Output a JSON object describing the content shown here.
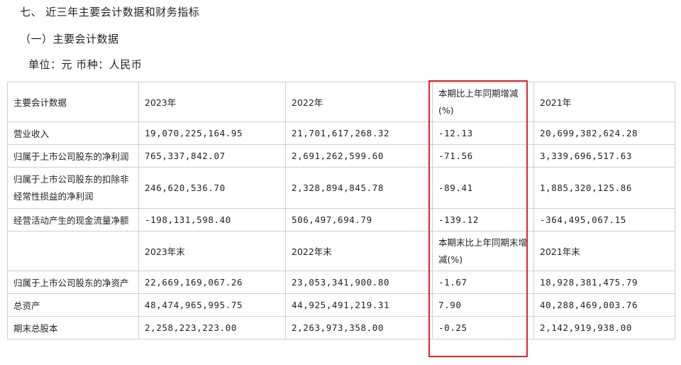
{
  "headings": {
    "section": "七、 近三年主要会计数据和财务指标",
    "subsection": "（一）主要会计数据",
    "unit_line": "单位：元  币种：人民币"
  },
  "table": {
    "header1": [
      "主要会计数据",
      "2023年",
      "2022年",
      "本期比上年同期增减(%)",
      "2021年"
    ],
    "rows1": [
      [
        "营业收入",
        "19,070,225,164.95",
        "21,701,617,268.32",
        "-12.13",
        "20,699,382,624.28"
      ],
      [
        "归属于上市公司股东的净利润",
        "765,337,842.07",
        "2,691,262,599.60",
        "-71.56",
        "3,339,696,517.63"
      ],
      [
        "归属于上市公司股东的扣除非经常性损益的净利润",
        "246,620,536.70",
        "2,328,894,845.78",
        "-89.41",
        "1,885,320,125.86"
      ],
      [
        "经营活动产生的现金流量净额",
        "-198,131,598.40",
        "506,497,694.79",
        "-139.12",
        "-364,495,067.15"
      ]
    ],
    "header2": [
      "",
      "2023年末",
      "2022年末",
      "本期末比上年同期末增减(%)",
      "2021年末"
    ],
    "rows2": [
      [
        "归属于上市公司股东的净资产",
        "22,669,169,067.26",
        "23,053,341,900.80",
        "-1.67",
        "18,928,381,475.79"
      ],
      [
        "总资产",
        "48,474,965,995.75",
        "44,925,491,219.31",
        "7.90",
        "40,288,469,003.76"
      ],
      [
        "期末总股本",
        "2,258,223,223.00",
        "2,263,973,358.00",
        "-0.25",
        "2,142,919,938.00"
      ]
    ]
  },
  "colors": {
    "highlight": "#e0252b",
    "border": "#cfcfcf",
    "text": "#222222"
  }
}
